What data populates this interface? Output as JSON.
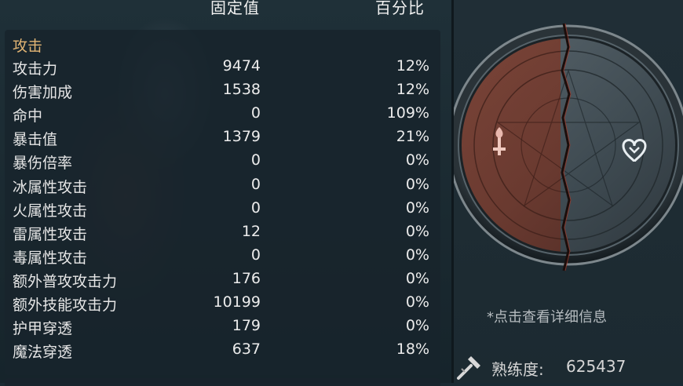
{
  "header": {
    "fixed_label": "固定值",
    "percent_label": "百分比"
  },
  "attack": {
    "title": "攻击",
    "rows": [
      {
        "label": "攻击力",
        "fixed": "9474",
        "percent": "12%"
      },
      {
        "label": "伤害加成",
        "fixed": "1538",
        "percent": "12%"
      },
      {
        "label": "命中",
        "fixed": "0",
        "percent": "109%"
      },
      {
        "label": "暴击值",
        "fixed": "1379",
        "percent": "21%"
      },
      {
        "label": "暴伤倍率",
        "fixed": "0",
        "percent": "0%"
      },
      {
        "label": "冰属性攻击",
        "fixed": "0",
        "percent": "0%"
      },
      {
        "label": "火属性攻击",
        "fixed": "0",
        "percent": "0%"
      },
      {
        "label": "雷属性攻击",
        "fixed": "12",
        "percent": "0%"
      },
      {
        "label": "毒属性攻击",
        "fixed": "0",
        "percent": "0%"
      },
      {
        "label": "额外普攻攻击力",
        "fixed": "176",
        "percent": "0%"
      },
      {
        "label": "额外技能攻击力",
        "fixed": "10199",
        "percent": "0%"
      },
      {
        "label": "护甲穿透",
        "fixed": "179",
        "percent": "0%"
      },
      {
        "label": "魔法穿透",
        "fixed": "637",
        "percent": "18%"
      }
    ]
  },
  "emblem": {
    "left_icon": "sword-icon",
    "right_icon": "heart-shield-icon"
  },
  "info": {
    "hint": "*点击查看详细信息",
    "proficiency_label": "熟练度:",
    "proficiency_value": "625437",
    "proficiency_icon": "hammer-icon"
  },
  "colors": {
    "section_title": "#e2b574",
    "panel_bg": "#18242c",
    "emblem_red": "#8a3a2a",
    "emblem_steel": "#4b5960"
  }
}
